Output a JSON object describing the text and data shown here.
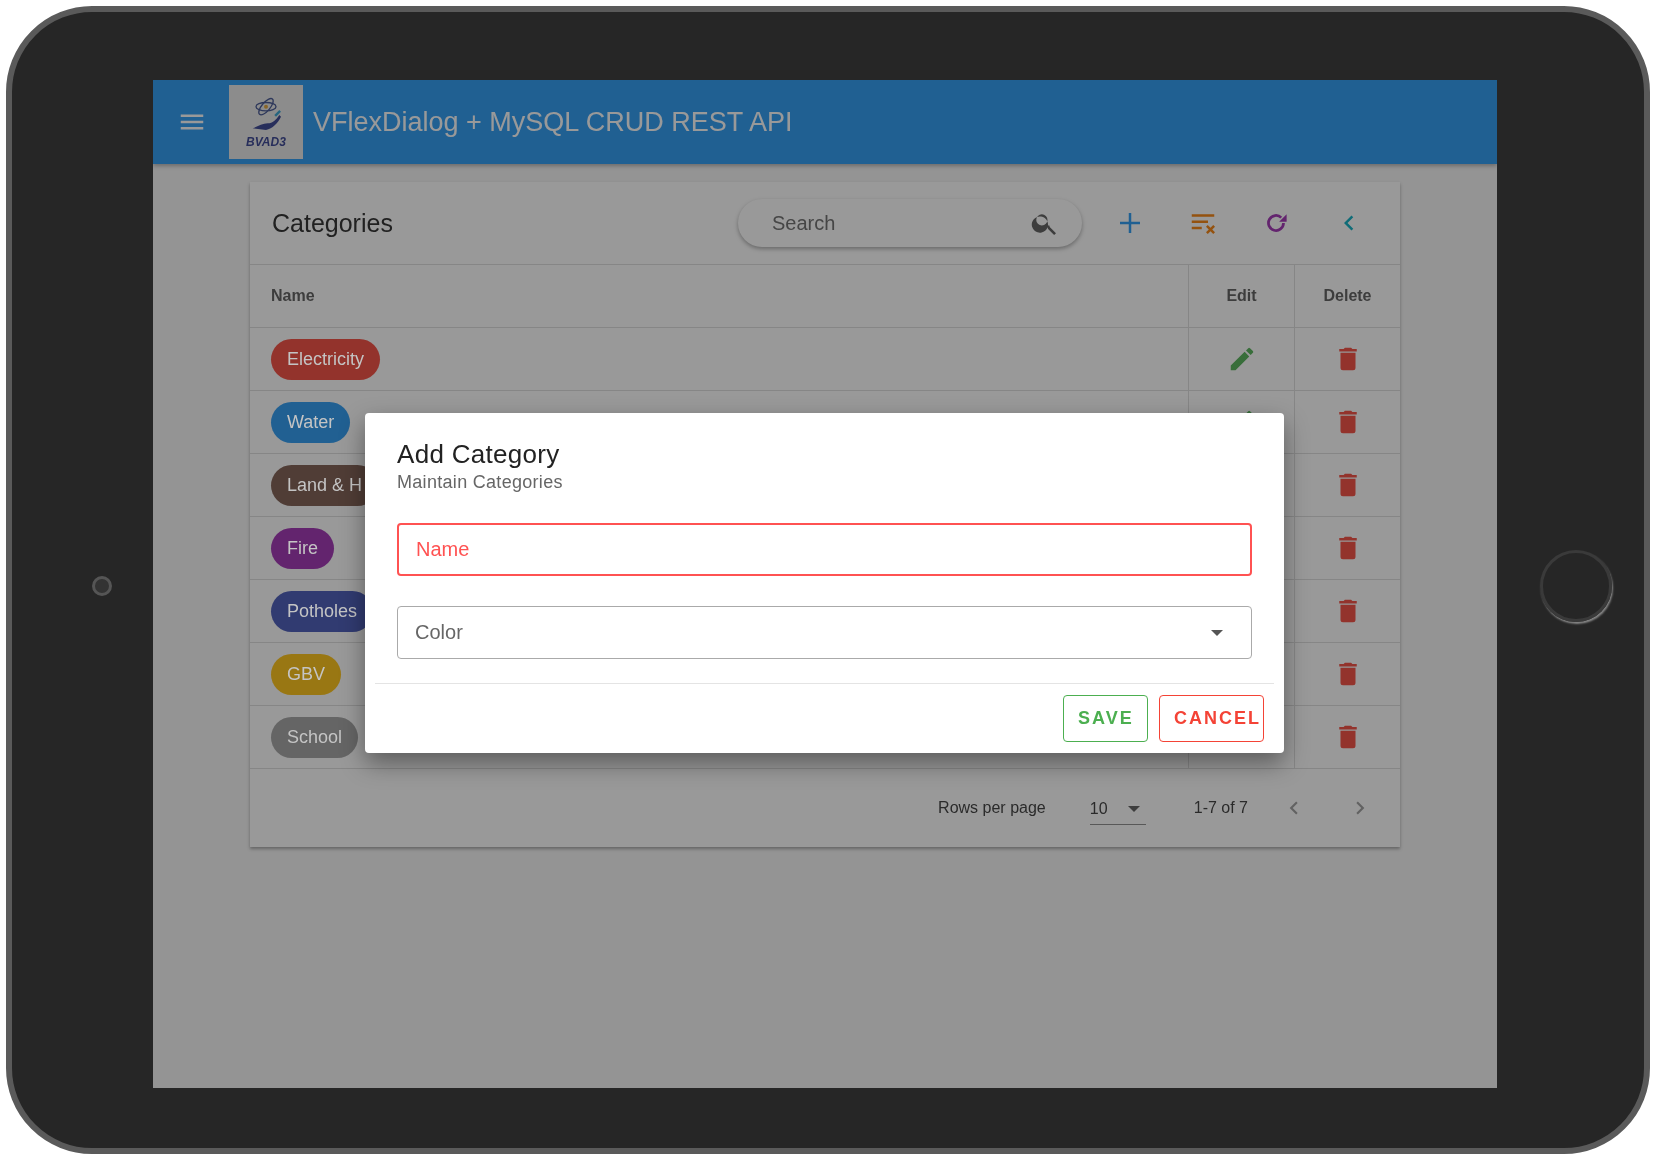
{
  "app_bar": {
    "title": "VFlexDialog + MySQL CRUD REST API",
    "logo_text": "BVAD3"
  },
  "card": {
    "title": "Categories",
    "search": {
      "placeholder": "Search"
    }
  },
  "table": {
    "columns": [
      "Name",
      "Edit",
      "Delete"
    ],
    "rows": [
      {
        "name": "Electricity",
        "color": "#93332c"
      },
      {
        "name": "Water",
        "color": "#216092"
      },
      {
        "name": "Land & H",
        "color": "#503d36"
      },
      {
        "name": "Fire",
        "color": "#63246e"
      },
      {
        "name": "Potholes",
        "color": "#313b71"
      },
      {
        "name": "GBV",
        "color": "#997713"
      },
      {
        "name": "School",
        "color": "#656565"
      }
    ]
  },
  "footer": {
    "rows_per_page_label": "Rows per page",
    "rows_per_page": "10",
    "range": "1-7 of 7"
  },
  "dialog": {
    "title": "Add Category",
    "subtitle": "Maintain Categories",
    "fields": [
      {
        "kind": "text",
        "placeholder": "Name",
        "error": true
      },
      {
        "kind": "select",
        "placeholder": "Color",
        "error": false
      }
    ],
    "buttons": [
      {
        "label": "SAVE",
        "kind": "save"
      },
      {
        "label": "CANCEL",
        "kind": "cancel"
      }
    ]
  }
}
